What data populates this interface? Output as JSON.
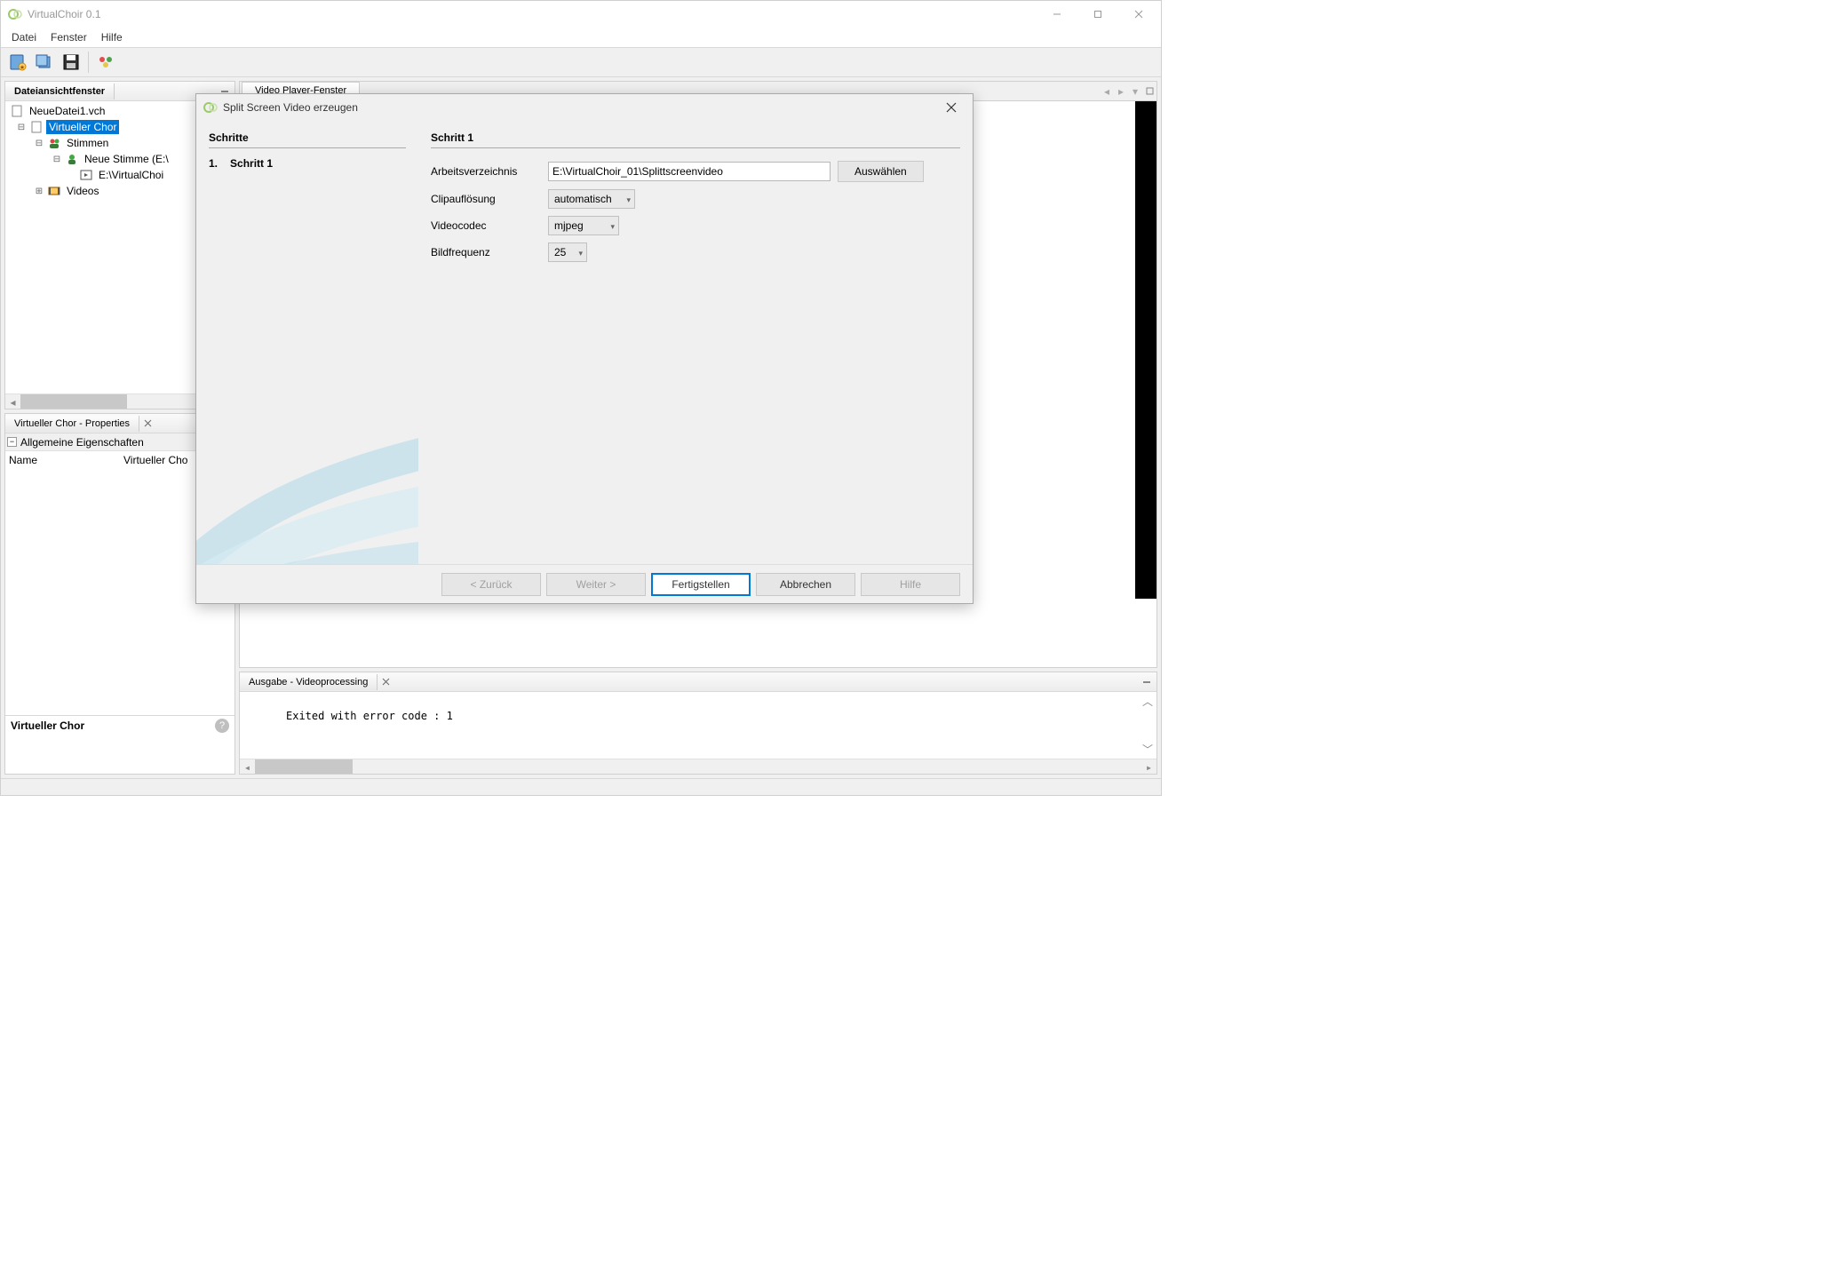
{
  "window": {
    "title": "VirtualChoir 0.1"
  },
  "menu": {
    "file": "Datei",
    "window": "Fenster",
    "help": "Hilfe"
  },
  "panels": {
    "fileview": {
      "title": "Dateiansichtfenster"
    },
    "videoplayer": {
      "title": "Video Player-Fenster"
    },
    "properties": {
      "title": "Virtueller Chor - Properties"
    },
    "output": {
      "title": "Ausgabe - Videoprocessing"
    }
  },
  "tree": {
    "root": "NeueDatei1.vch",
    "chor": "Virtueller Chor",
    "stimmen": "Stimmen",
    "neue_stimme": "Neue Stimme (E:\\",
    "stimme_path": "E:\\VirtualChoi",
    "videos": "Videos"
  },
  "properties": {
    "section": "Allgemeine Eigenschaften",
    "rows": [
      {
        "key": "Name",
        "value": "Virtueller Cho"
      }
    ],
    "category": "Virtueller Chor"
  },
  "output": {
    "text": "Exited with error code : 1"
  },
  "dialog": {
    "title": "Split Screen Video erzeugen",
    "steps_header": "Schritte",
    "step1_num": "1.",
    "step1_label": "Schritt 1",
    "right_header": "Schritt 1",
    "workdir_label": "Arbeitsverzeichnis",
    "workdir_value": "E:\\VirtualChoir_01\\Splittscreenvideo",
    "choose": "Auswählen",
    "resolution_label": "Clipauflösung",
    "resolution_value": "automatisch",
    "codec_label": "Videocodec",
    "codec_value": "mjpeg",
    "fps_label": "Bildfrequenz",
    "fps_value": "25",
    "back": "< Zurück",
    "next": "Weiter >",
    "finish": "Fertigstellen",
    "cancel": "Abbrechen",
    "help": "Hilfe"
  }
}
